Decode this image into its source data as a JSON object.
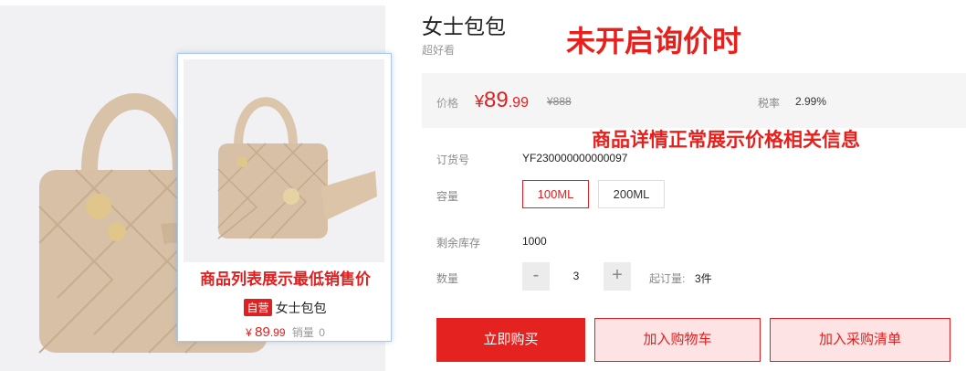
{
  "product": {
    "title": "女士包包",
    "subtitle": "超好看"
  },
  "annotations": {
    "top": "未开启询价时",
    "middle": "商品详情正常展示价格相关信息",
    "card": "商品列表展示最低销售价"
  },
  "price_bar": {
    "label": "价格",
    "currency": "¥",
    "price_int": "89",
    "price_dec": ".99",
    "original_price": "¥888",
    "tax_label": "税率",
    "tax_value": "2.99%"
  },
  "order_no": {
    "label": "订货号",
    "value": "YF230000000000097"
  },
  "capacity": {
    "label": "容量",
    "options": [
      "100ML",
      "200ML"
    ],
    "selected": "100ML"
  },
  "stock": {
    "label": "剩余库存",
    "value": "1000"
  },
  "quantity": {
    "label": "数量",
    "minus": "-",
    "plus": "+",
    "value": "3",
    "min_label": "起订量:",
    "min_value": "3件"
  },
  "actions": {
    "buy": "立即购买",
    "add_cart": "加入购物车",
    "add_purchase_list": "加入采购清单"
  },
  "list_card": {
    "badge": "自营",
    "name": "女士包包",
    "currency": "¥",
    "price_int": "89",
    "price_dec": ".99",
    "sold_label": "销量",
    "sold_value": "0"
  },
  "colors": {
    "accent": "#e02020",
    "light_accent_bg": "#fde3e3",
    "gallery_bg": "#f1f1f3",
    "price_bar_bg": "#f5f5f5"
  }
}
